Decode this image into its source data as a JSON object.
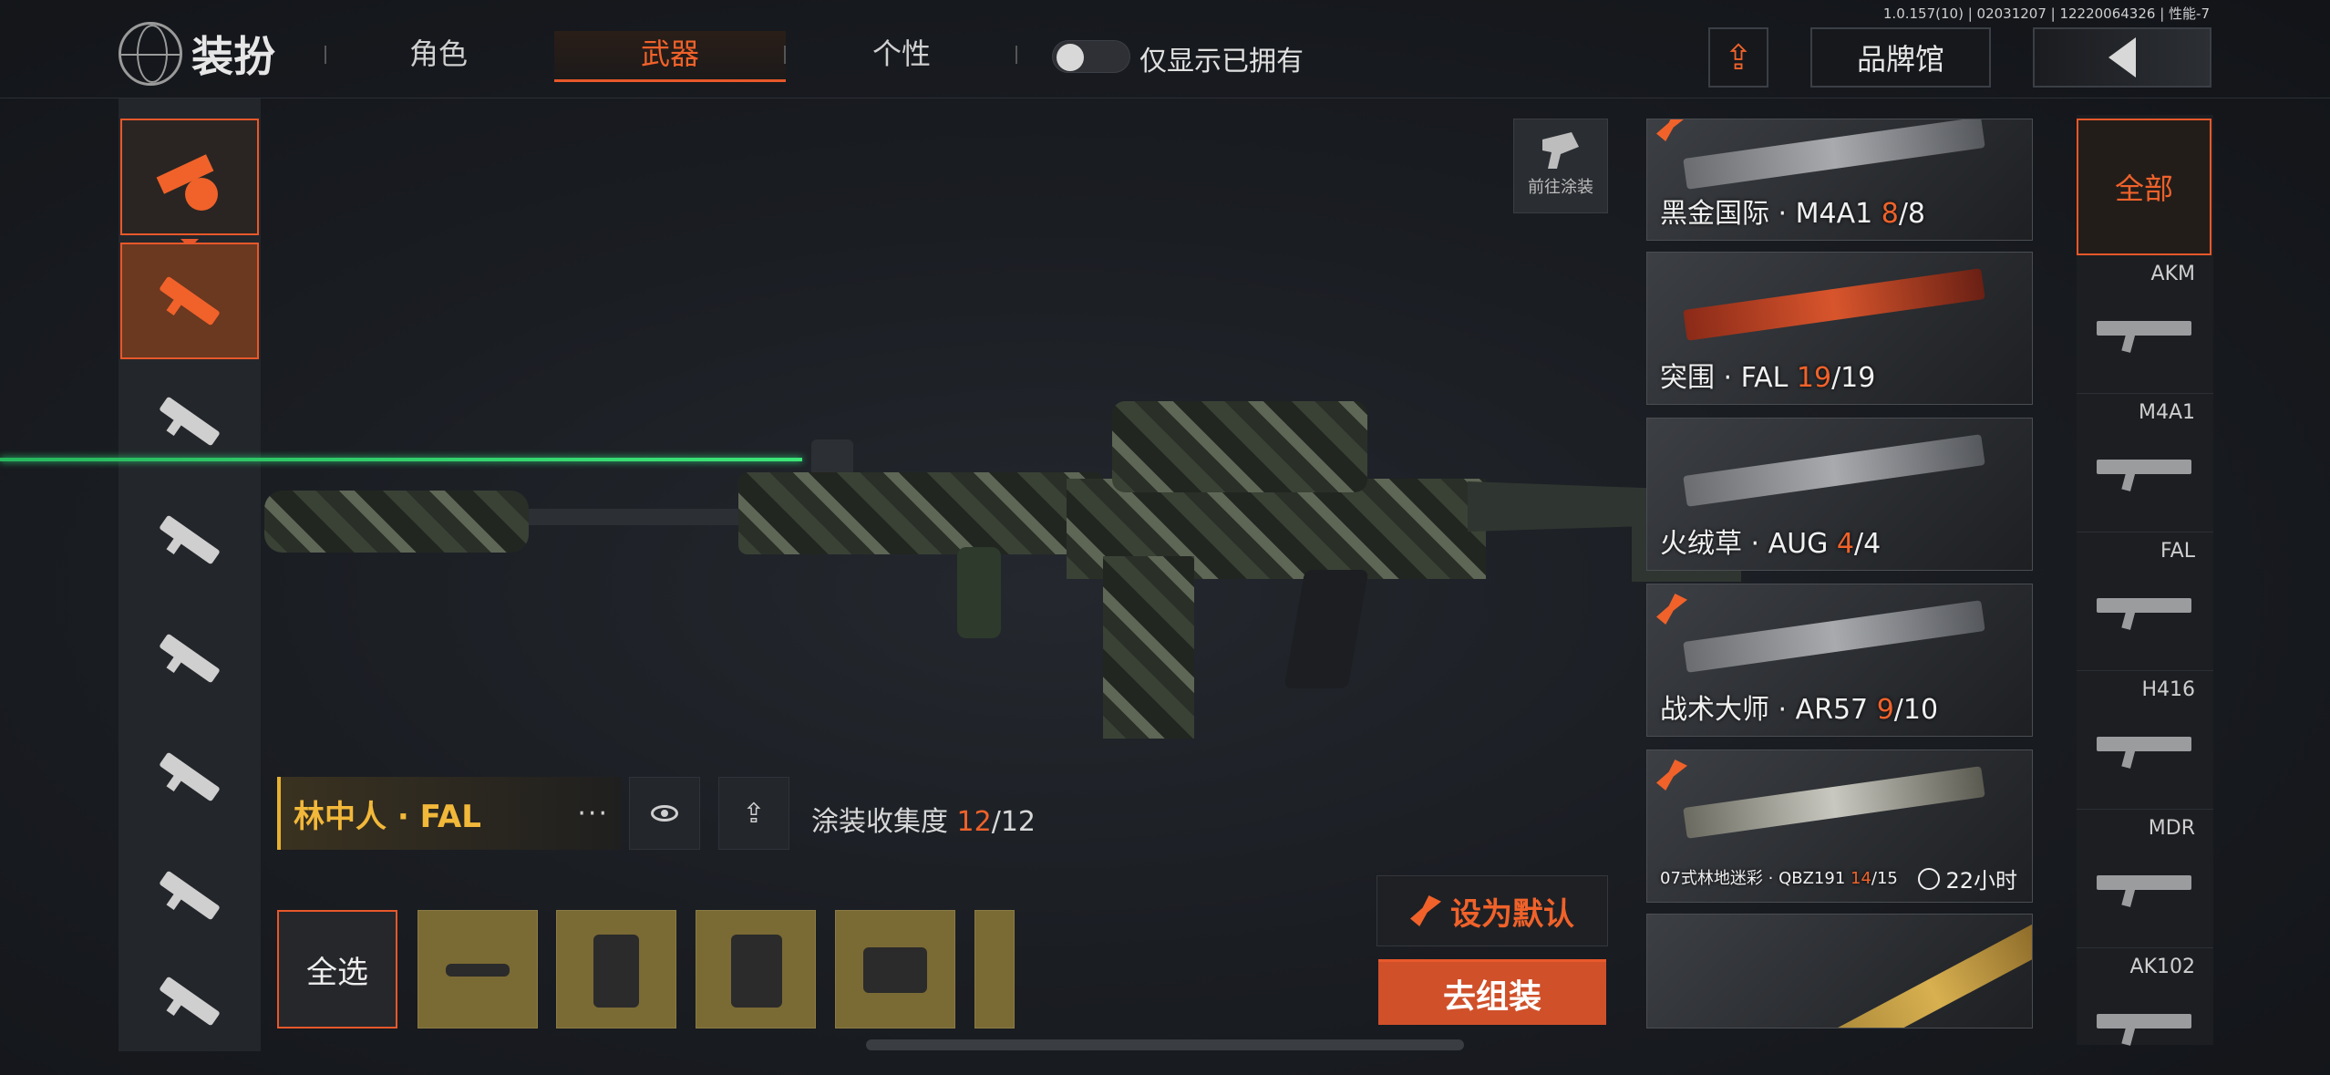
{
  "version": "1.0.157(10) | 02031207 | 12220064326 | 性能-7",
  "header": {
    "title": "装扮",
    "tabs": [
      "角色",
      "武器",
      "个性"
    ],
    "active_tab": "武器",
    "toggle_label": "仅显示已拥有",
    "toggle_on": false,
    "brand_button": "品牌馆"
  },
  "left_sidebar": {
    "icons": [
      "weapon-category-icon",
      "assault-rifle-icon",
      "smg-icon",
      "sniper-icon",
      "marksman-rifle-icon",
      "rifle-icon",
      "shotgun-icon",
      "rifle-icon"
    ],
    "active_index": 1
  },
  "skin": {
    "name": "林中人 · FAL",
    "more": "···",
    "collect_label": "涂装收集度",
    "collect_current": "12",
    "collect_total": "/12"
  },
  "parts": {
    "select_all": "全选",
    "count": 5
  },
  "go_paint": "前往涂装",
  "actions": {
    "set_default": "设为默认",
    "assemble": "去组装"
  },
  "cards": [
    {
      "name": "黑金国际 · M4A1 ",
      "owned": "8",
      "total": "/8",
      "style": "",
      "tag": true
    },
    {
      "name": "突围 · FAL ",
      "owned": "19",
      "total": "/19",
      "style": "red",
      "tag": false
    },
    {
      "name": "火绒草 · AUG ",
      "owned": "4",
      "total": "/4",
      "style": "",
      "tag": false
    },
    {
      "name": "战术大师 · AR57 ",
      "owned": "9",
      "total": "/10",
      "style": "",
      "tag": true
    },
    {
      "name": "07式林地迷彩 · QBZ191 ",
      "owned": "14",
      "total": "/15",
      "style": "camo2",
      "tag": true,
      "timer": "22小时"
    },
    {
      "name": "",
      "owned": "",
      "total": "",
      "style": "gold",
      "tag": false
    }
  ],
  "filters": {
    "all": "全部",
    "items": [
      "AKM",
      "M4A1",
      "FAL",
      "H416",
      "MDR",
      "AK102"
    ]
  },
  "colors": {
    "accent": "#e8582a",
    "gold": "#f2b83a",
    "laser": "#2fd37a"
  }
}
